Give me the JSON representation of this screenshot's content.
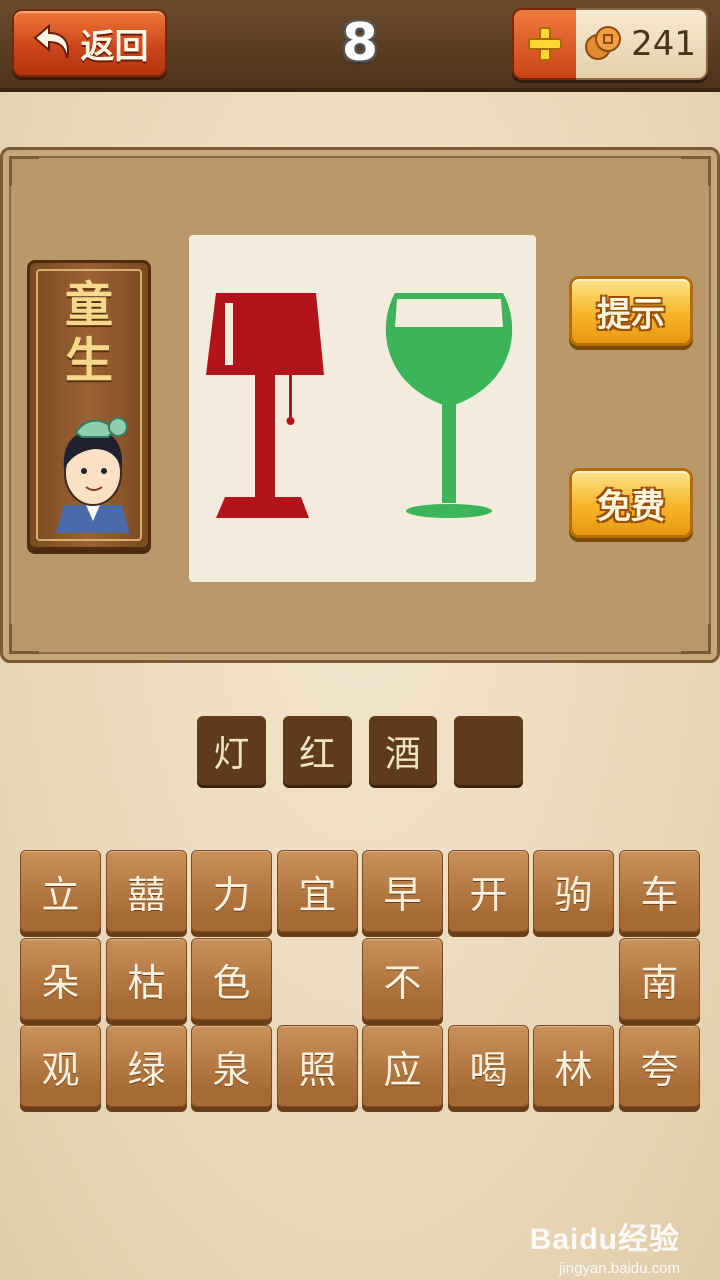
{
  "header": {
    "back_label": "返回",
    "level": "8",
    "coins": "241"
  },
  "card": {
    "title_chars": [
      "童",
      "生"
    ]
  },
  "puzzle": {
    "left_object_color": "#b2141c",
    "right_object_color": "#3cb45a"
  },
  "side_buttons": {
    "hint_label": "提示",
    "free_label": "免费"
  },
  "answer_slots": [
    "灯",
    "红",
    "酒",
    ""
  ],
  "letter_grid": {
    "rows": [
      [
        "立",
        "囍",
        "力",
        "宜",
        "早",
        "开",
        "驹",
        "车"
      ],
      [
        "朵",
        "枯",
        "色",
        "",
        "不",
        "",
        "",
        "南"
      ],
      [
        "观",
        "绿",
        "泉",
        "照",
        "应",
        "喝",
        "林",
        "夸"
      ]
    ]
  },
  "watermark": {
    "brand": "Baidu经验",
    "url": "jingyan.baidu.com"
  }
}
